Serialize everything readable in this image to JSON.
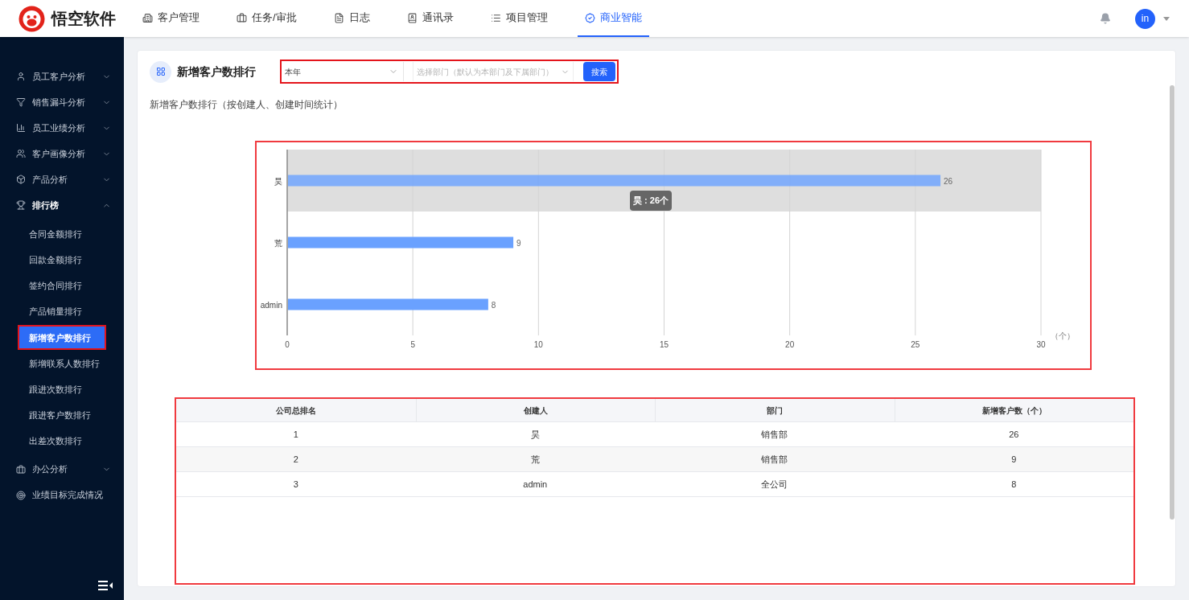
{
  "header": {
    "logo_text": "悟空软件",
    "nav": [
      {
        "label": "客户管理",
        "selected": false
      },
      {
        "label": "任务/审批",
        "selected": false
      },
      {
        "label": "日志",
        "selected": false
      },
      {
        "label": "通讯录",
        "selected": false
      },
      {
        "label": "项目管理",
        "selected": false
      },
      {
        "label": "商业智能",
        "selected": true
      }
    ],
    "avatar": "in"
  },
  "sidebar": {
    "items": [
      {
        "label": "员工客户分析",
        "expanded": false
      },
      {
        "label": "销售漏斗分析",
        "expanded": false
      },
      {
        "label": "员工业绩分析",
        "expanded": false
      },
      {
        "label": "客户画像分析",
        "expanded": false
      },
      {
        "label": "产品分析",
        "expanded": false
      },
      {
        "label": "排行榜",
        "expanded": true,
        "children": [
          {
            "label": "合同金额排行",
            "selected": false,
            "highlighted": false
          },
          {
            "label": "回款金额排行",
            "selected": false,
            "highlighted": false
          },
          {
            "label": "签约合同排行",
            "selected": false,
            "highlighted": false
          },
          {
            "label": "产品销量排行",
            "selected": false,
            "highlighted": false
          },
          {
            "label": "新增客户数排行",
            "selected": true,
            "highlighted": true
          },
          {
            "label": "新增联系人数排行",
            "selected": false,
            "highlighted": false
          },
          {
            "label": "跟进次数排行",
            "selected": false,
            "highlighted": false
          },
          {
            "label": "跟进客户数排行",
            "selected": false,
            "highlighted": false
          },
          {
            "label": "出差次数排行",
            "selected": false,
            "highlighted": false
          }
        ]
      },
      {
        "label": "办公分析",
        "expanded": false
      },
      {
        "label": "业绩目标完成情况"
      }
    ]
  },
  "page": {
    "title": "新增客户数排行",
    "filters": {
      "highlighted": true,
      "period": "本年",
      "department_placeholder": "选择部门（默认为本部门及下属部门）",
      "search_button": "搜索"
    },
    "subtitle": "新增客户数排行（按创建人、创建时间统计）",
    "chart": {
      "highlighted": true,
      "hover": [
        true,
        false,
        false
      ],
      "tooltip": "昊 : 26个",
      "chart_data": {
        "type": "bar",
        "orientation": "horizontal",
        "categories": [
          "昊",
          "荒",
          "admin"
        ],
        "series": [
          {
            "color": "#6aa1ff",
            "values": [
              26,
              9,
              8
            ]
          }
        ],
        "xlabel": "（个）",
        "xlim": [
          0,
          30
        ],
        "xticks": [
          0,
          5,
          10,
          15,
          20,
          25,
          30
        ],
        "data_labels": true,
        "grid": true
      }
    },
    "table": {
      "highlighted": true,
      "columns": [
        "公司总排名",
        "创建人",
        "部门",
        "新增客户数（个）"
      ],
      "rows": [
        [
          "1",
          "昊",
          "销售部",
          "26"
        ],
        [
          "2",
          "荒",
          "销售部",
          "9"
        ],
        [
          "3",
          "admin",
          "全公司",
          "8"
        ]
      ]
    }
  }
}
